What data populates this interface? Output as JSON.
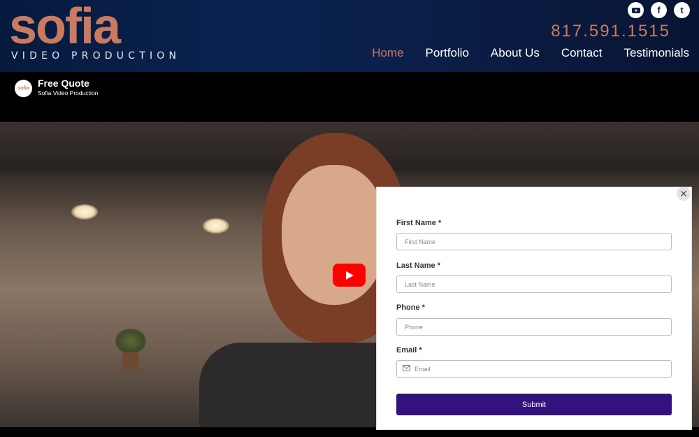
{
  "brand": {
    "logo_text": "sofia",
    "logo_subtitle": "VIDEO PRODUCTION",
    "accent_color": "#c97a5f"
  },
  "header": {
    "phone": "817.591.1515",
    "social": [
      {
        "icon": "youtube-icon",
        "glyph": "▶"
      },
      {
        "icon": "facebook-icon",
        "glyph": "f"
      },
      {
        "icon": "tumblr-icon",
        "glyph": "t"
      }
    ],
    "nav": [
      {
        "label": "Home",
        "active": true
      },
      {
        "label": "Portfolio",
        "active": false
      },
      {
        "label": "About Us",
        "active": false
      },
      {
        "label": "Contact",
        "active": false
      },
      {
        "label": "Testimonials",
        "active": false
      }
    ]
  },
  "video": {
    "title": "Free Quote",
    "channel": "Sofia Video Production",
    "avatar_text": "sofia"
  },
  "form": {
    "fields": [
      {
        "label": "First Name *",
        "placeholder": "First Name"
      },
      {
        "label": "Last Name *",
        "placeholder": "Last Name"
      },
      {
        "label": "Phone *",
        "placeholder": "Phone"
      },
      {
        "label": "Email *",
        "placeholder": "Email"
      }
    ],
    "submit_label": "Submit",
    "close_glyph": "✕",
    "button_color": "#33127d"
  }
}
